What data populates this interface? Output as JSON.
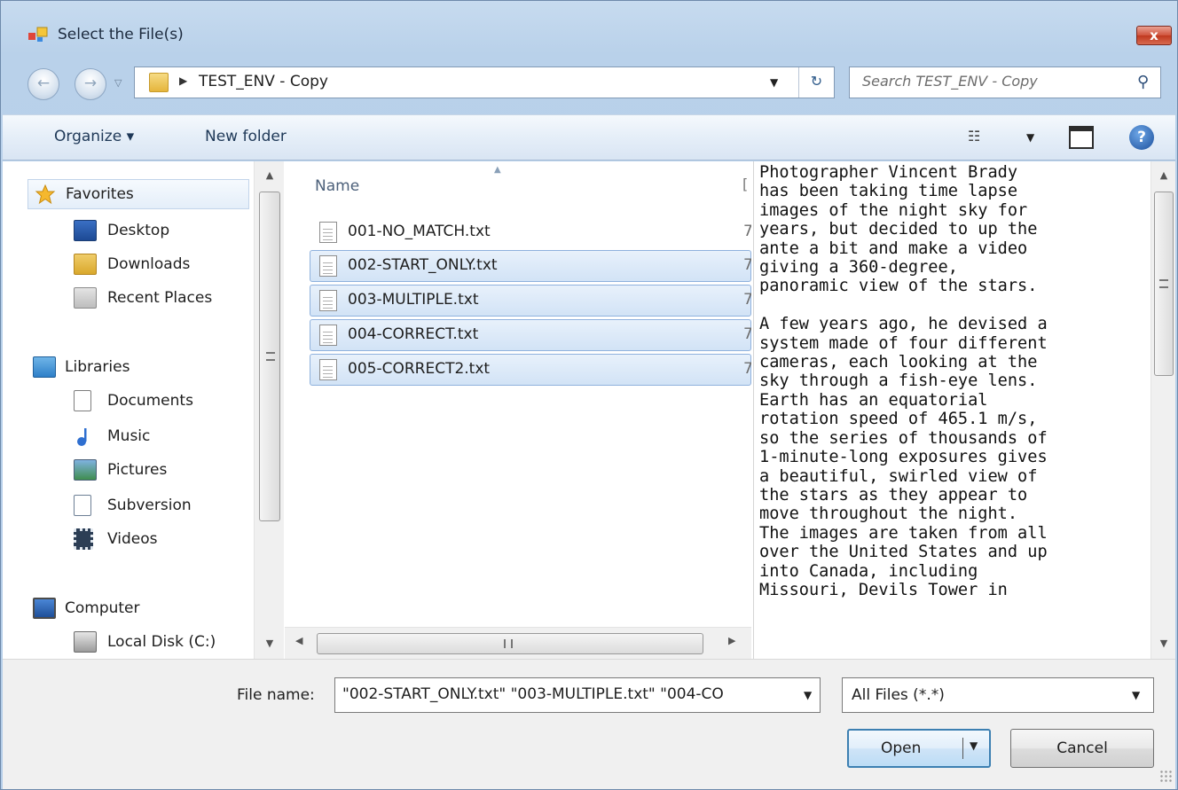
{
  "window": {
    "title": "Select the File(s)",
    "close_label": "x"
  },
  "address": {
    "path": "TEST_ENV - Copy",
    "search_placeholder": "Search TEST_ENV - Copy"
  },
  "toolbar": {
    "organize": "Organize ▾",
    "new_folder": "New folder"
  },
  "nav": {
    "favorites": "Favorites",
    "desktop": "Desktop",
    "downloads": "Downloads",
    "recent_places": "Recent Places",
    "libraries": "Libraries",
    "documents": "Documents",
    "music": "Music",
    "pictures": "Pictures",
    "subversion": "Subversion",
    "videos": "Videos",
    "computer": "Computer",
    "local_disk": "Local Disk (C:)"
  },
  "filelist": {
    "col_name": "Name",
    "col_next": "[",
    "files": [
      {
        "name": "001-NO_MATCH.txt",
        "trail": "7",
        "selected": false
      },
      {
        "name": "002-START_ONLY.txt",
        "trail": "7",
        "selected": true
      },
      {
        "name": "003-MULTIPLE.txt",
        "trail": "7",
        "selected": true
      },
      {
        "name": "004-CORRECT.txt",
        "trail": "7",
        "selected": true
      },
      {
        "name": "005-CORRECT2.txt",
        "trail": "7",
        "selected": true
      }
    ]
  },
  "preview": {
    "text": "Photographer Vincent Brady\nhas been taking time lapse\nimages of the night sky for\nyears, but decided to up the\nante a bit and make a video\ngiving a 360-degree,\npanoramic view of the stars.\n\nA few years ago, he devised a\nsystem made of four different\ncameras, each looking at the\nsky through a fish-eye lens.\nEarth has an equatorial\nrotation speed of 465.1 m/s,\nso the series of thousands of\n1-minute-long exposures gives\na beautiful, swirled view of\nthe stars as they appear to\nmove throughout the night.\nThe images are taken from all\nover the United States and up\ninto Canada, including\nMissouri, Devils Tower in"
  },
  "bottom": {
    "filename_label": "File name:",
    "filename_value": "\"002-START_ONLY.txt\" \"003-MULTIPLE.txt\" \"004-CO",
    "filetype_value": "All Files (*.*)",
    "open_label": "Open",
    "cancel_label": "Cancel"
  },
  "colors": {
    "selection_border": "#8fb1dd",
    "frame": "#b9d1ea",
    "accent": "#3c7fb1"
  }
}
